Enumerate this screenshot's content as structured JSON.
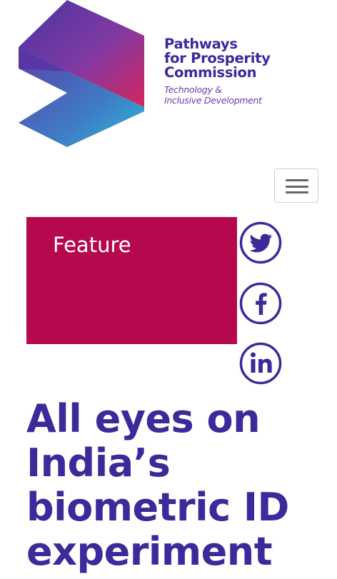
{
  "brand": {
    "title_lines": [
      "Pathways",
      "for Prosperity",
      "Commission"
    ],
    "subtitle_lines": [
      "Technology &",
      "Inclusive Development"
    ],
    "colors": {
      "primary": "#3a2a9a",
      "accent": "#b5084f",
      "teal": "#1aa6c9"
    }
  },
  "nav": {
    "menu_toggle_icon": "hamburger-menu-icon"
  },
  "feature": {
    "label": "Feature"
  },
  "social": {
    "icons": [
      "twitter-icon",
      "facebook-icon",
      "linkedin-icon"
    ],
    "color": "#3a2a9a"
  },
  "article": {
    "headline_lines": [
      "All eyes on",
      "India’s",
      "biometric ID",
      "experiment"
    ]
  }
}
